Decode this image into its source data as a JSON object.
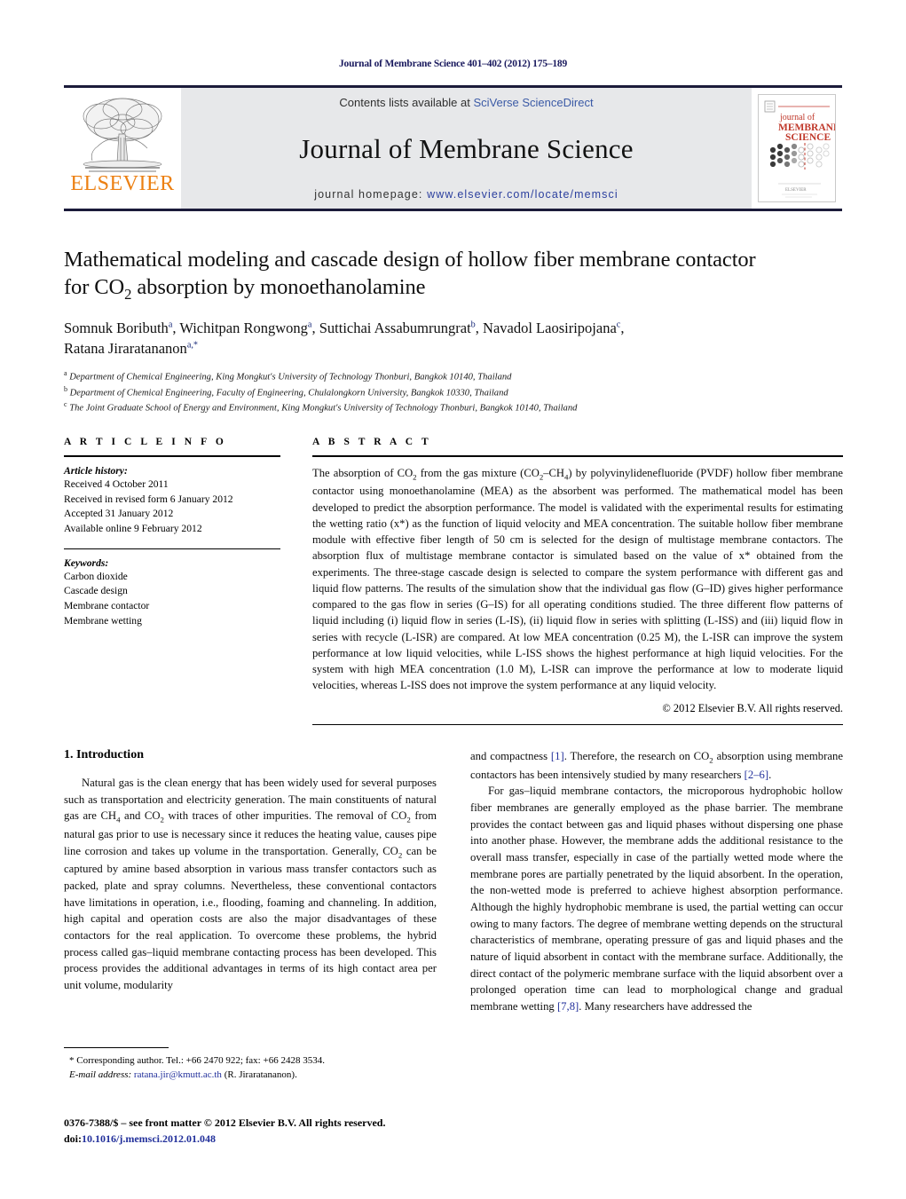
{
  "running_head": "Journal of Membrane Science 401–402 (2012) 175–189",
  "masthead": {
    "contents_prefix": "Contents lists available at ",
    "contents_link": "SciVerse ScienceDirect",
    "journal_title": "Journal of Membrane Science",
    "homepage_prefix": "journal homepage: ",
    "homepage_url": "www.elsevier.com/locate/memsci",
    "publisher_wordmark": "ELSEVIER",
    "publisher_color": "#ec8013",
    "link_color": "#3b5aa6",
    "band_color": "#e7e8ea",
    "cover": {
      "line1": "journal of",
      "line2": "MEMBRANE",
      "line3": "SCIENCE",
      "footer_brand": "Elsevier"
    }
  },
  "article": {
    "title_line1": "Mathematical modeling and cascade design of hollow fiber membrane contactor",
    "title_line2_pre": "for CO",
    "title_line2_sub": "2",
    "title_line2_post": " absorption by monoethanolamine",
    "authors_line1": "Somnuk Boributh",
    "authors": [
      {
        "name": "Somnuk Boributh",
        "mark": "a"
      },
      {
        "name": "Wichitpan Rongwong",
        "mark": "a"
      },
      {
        "name": "Suttichai Assabumrungrat",
        "mark": "b"
      },
      {
        "name": "Navadol Laosiripojana",
        "mark": "c"
      },
      {
        "name": "Ratana Jiraratananon",
        "mark": "a,*"
      }
    ],
    "affiliations": [
      {
        "mark": "a",
        "text": "Department of Chemical Engineering, King Mongkut's University of Technology Thonburi, Bangkok 10140, Thailand"
      },
      {
        "mark": "b",
        "text": "Department of Chemical Engineering, Faculty of Engineering, Chulalongkorn University, Bangkok 10330, Thailand"
      },
      {
        "mark": "c",
        "text": "The Joint Graduate School of Energy and Environment, King Mongkut's University of Technology Thonburi, Bangkok 10140, Thailand"
      }
    ]
  },
  "article_info": {
    "label": "A R T I C L E    I N F O",
    "history_label": "Article history:",
    "history": [
      "Received 4 October 2011",
      "Received in revised form 6 January 2012",
      "Accepted 31 January 2012",
      "Available online 9 February 2012"
    ],
    "keywords_label": "Keywords:",
    "keywords": [
      "Carbon dioxide",
      "Cascade design",
      "Membrane contactor",
      "Membrane wetting"
    ]
  },
  "abstract": {
    "label": "A B S T R A C T",
    "paragraph_1": "The absorption of CO",
    "text": "The absorption of CO2 from the gas mixture (CO2–CH4) by polyvinylidenefluoride (PVDF) hollow fiber membrane contactor using monoethanolamine (MEA) as the absorbent was performed. The mathematical model has been developed to predict the absorption performance. The model is validated with the experimental results for estimating the wetting ratio (x*) as the function of liquid velocity and MEA concentration. The suitable hollow fiber membrane module with effective fiber length of 50 cm is selected for the design of multistage membrane contactors. The absorption flux of multistage membrane contactor is simulated based on the value of x* obtained from the experiments. The three-stage cascade design is selected to compare the system performance with different gas and liquid flow patterns. The results of the simulation show that the individual gas flow (G–ID) gives higher performance compared to the gas flow in series (G–IS) for all operating conditions studied. The three different flow patterns of liquid including (i) liquid flow in series (L-IS), (ii) liquid flow in series with splitting (L-ISS) and (iii) liquid flow in series with recycle (L-ISR) are compared. At low MEA concentration (0.25 M), the L-ISR can improve the system performance at low liquid velocities, while L-ISS shows the highest performance at high liquid velocities. For the system with high MEA concentration (1.0 M), L-ISR can improve the performance at low to moderate liquid velocities, whereas L-ISS does not improve the system performance at any liquid velocity.",
    "copyright": "© 2012 Elsevier B.V. All rights reserved."
  },
  "introduction": {
    "heading": "1.  Introduction",
    "left_paragraph": "Natural gas is the clean energy that has been widely used for several purposes such as transportation and electricity generation. The main constituents of natural gas are CH4 and CO2 with traces of other impurities. The removal of CO2 from natural gas prior to use is necessary since it reduces the heating value, causes pipe line corrosion and takes up volume in the transportation. Generally, CO2 can be captured by amine based absorption in various mass transfer contactors such as packed, plate and spray columns. Nevertheless, these conventional contactors have limitations in operation, i.e., flooding, foaming and channeling. In addition, high capital and operation costs are also the major disadvantages of these contactors for the real application. To overcome these problems, the hybrid process called gas–liquid membrane contacting process has been developed. This process provides the additional advantages in terms of its high contact area per unit volume, modularity",
    "right_paragraph_1": "and compactness [1]. Therefore, the research on CO2 absorption using membrane contactors has been intensively studied by many researchers [2–6].",
    "right_paragraph_2": "For gas–liquid membrane contactors, the microporous hydrophobic hollow fiber membranes are generally employed as the phase barrier. The membrane provides the contact between gas and liquid phases without dispersing one phase into another phase. However, the membrane adds the additional resistance to the overall mass transfer, especially in case of the partially wetted mode where the membrane pores are partially penetrated by the liquid absorbent. In the operation, the non-wetted mode is preferred to achieve highest absorption performance. Although the highly hydrophobic membrane is used, the partial wetting can occur owing to many factors. The degree of membrane wetting depends on the structural characteristics of membrane, operating pressure of gas and liquid phases and the nature of liquid absorbent in contact with the membrane surface. Additionally, the direct contact of the polymeric membrane surface with the liquid absorbent over a prolonged operation time can lead to morphological change and gradual membrane wetting [7,8]. Many researchers have addressed the",
    "refs": {
      "r1": "[1]",
      "r2": "[2–6]",
      "r3": "[7,8]"
    }
  },
  "footnote": {
    "corresponding": "* Corresponding author. Tel.: +66 2470 922; fax: +66 2428 3534.",
    "email_label": "E-mail address:",
    "email": "ratana.jir@kmutt.ac.th",
    "email_suffix": "(R. Jiraratananon)."
  },
  "imprint": {
    "issn_line": "0376-7388/$ – see front matter © 2012 Elsevier B.V. All rights reserved.",
    "doi_label": "doi:",
    "doi_value": "10.1016/j.memsci.2012.01.048"
  }
}
